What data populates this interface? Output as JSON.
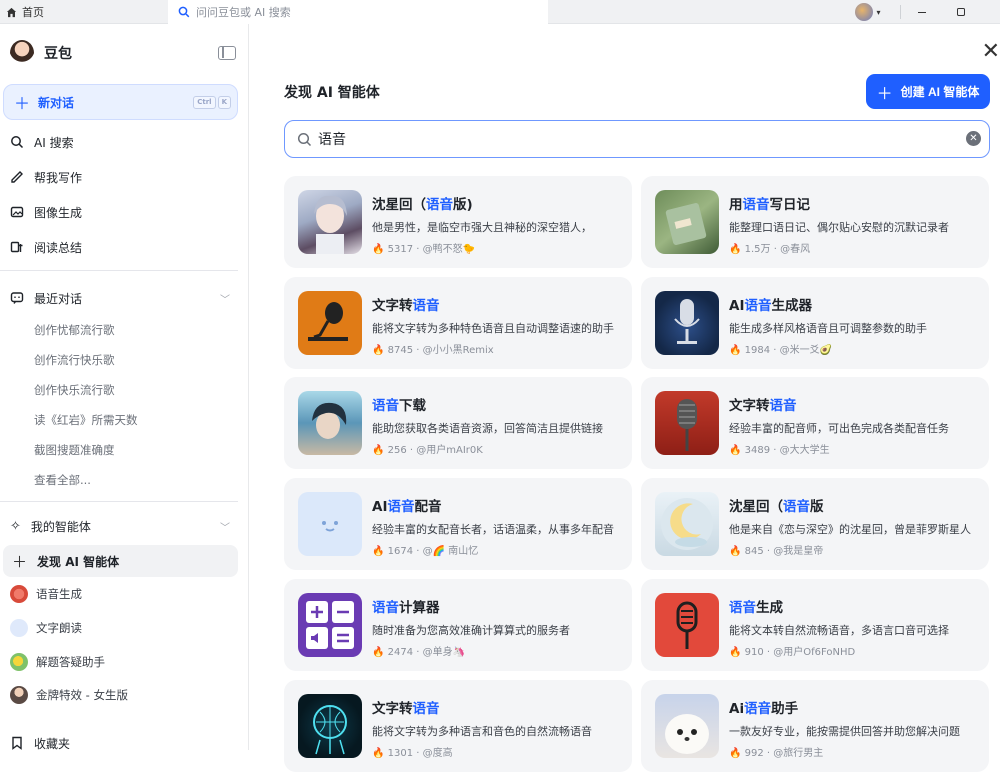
{
  "titlebar": {
    "home_tab": "首页",
    "search_placeholder": "问问豆包或 AI 搜索"
  },
  "sidebar": {
    "brand": "豆包",
    "new_chat": {
      "label": "新对话",
      "shortcut": [
        "Ctrl",
        "K"
      ]
    },
    "nav": [
      {
        "label": "AI 搜索",
        "icon": "ai-search-icon"
      },
      {
        "label": "帮我写作",
        "icon": "pen-icon"
      },
      {
        "label": "图像生成",
        "icon": "image-icon"
      },
      {
        "label": "阅读总结",
        "icon": "reading-icon"
      }
    ],
    "recent": {
      "label": "最近对话",
      "items": [
        "创作忧郁流行歌",
        "创作流行快乐歌",
        "创作快乐流行歌",
        "读《红岩》所需天数",
        "截图搜题准确度",
        "查看全部..."
      ]
    },
    "my_agents": {
      "label": "我的智能体"
    },
    "discover_label": "发现 AI 智能体",
    "agents": [
      "语音生成",
      "文字朗读",
      "解题答疑助手",
      "金牌特效 - 女生版"
    ],
    "favorites": "收藏夹"
  },
  "main": {
    "title": "发现 AI 智能体",
    "create_label": "创建 AI 智能体",
    "search_value": "语音"
  },
  "cards": [
    {
      "title_pre": "沈星回（",
      "title_hl": "语音",
      "title_post": "版)",
      "desc": "他是男性，是临空市强大且神秘的深空猎人，",
      "uses": "5317",
      "author": "@鸭不怒🐤"
    },
    {
      "title_pre": "用",
      "title_hl": "语音",
      "title_post": "写日记",
      "desc": "能整理口语日记、偶尔贴心安慰的沉默记录者",
      "uses": "1.5万",
      "author": "@春风"
    },
    {
      "title_pre": "文字转",
      "title_hl": "语音",
      "title_post": "",
      "desc": "能将文字转为多种特色语音且自动调整语速的助手",
      "uses": "8745",
      "author": "@小小黑Remix"
    },
    {
      "title_pre": "AI",
      "title_hl": "语音",
      "title_post": "生成器",
      "desc": "能生成多样风格语音且可调整参数的助手",
      "uses": "1984",
      "author": "@米一爻🥑"
    },
    {
      "title_pre": "",
      "title_hl": "语音",
      "title_post": "下载",
      "desc": "能助您获取各类语音资源，回答简洁且提供链接",
      "uses": "256",
      "author": "@用户mAIr0K"
    },
    {
      "title_pre": "文字转",
      "title_hl": "语音",
      "title_post": "",
      "desc": "经验丰富的配音师，可出色完成各类配音任务",
      "uses": "3489",
      "author": "@大大学生"
    },
    {
      "title_pre": "AI",
      "title_hl": "语音",
      "title_post": "配音",
      "desc": "经验丰富的女配音长者，话语温柔，从事多年配音",
      "uses": "1674",
      "author": "@🌈 南山忆"
    },
    {
      "title_pre": "沈星回（",
      "title_hl": "语音",
      "title_post": "版",
      "desc": "他是来自《恋与深空》的沈星回，曾是菲罗斯星人",
      "uses": "845",
      "author": "@我是皇帝"
    },
    {
      "title_pre": "",
      "title_hl": "语音",
      "title_post": "计算器",
      "desc": "随时准备为您高效准确计算算式的服务者",
      "uses": "2474",
      "author": "@单身🦄"
    },
    {
      "title_pre": "",
      "title_hl": "语音",
      "title_post": "生成",
      "desc": "能将文本转自然流畅语音，多语言口音可选择",
      "uses": "910",
      "author": "@用户Of6FoNHD"
    },
    {
      "title_pre": "文字转",
      "title_hl": "语音",
      "title_post": "",
      "desc": "能将文字转为多种语言和音色的自然流畅语音",
      "uses": "1301",
      "author": "@度高"
    },
    {
      "title_pre": "Ai",
      "title_hl": "语音",
      "title_post": "助手",
      "desc": "一款友好专业，能按需提供回答并助您解决问题",
      "uses": "992",
      "author": "@旅行男主"
    }
  ],
  "colors": {
    "accent": "#1f5fff",
    "card_bg": "#f4f5f7"
  }
}
